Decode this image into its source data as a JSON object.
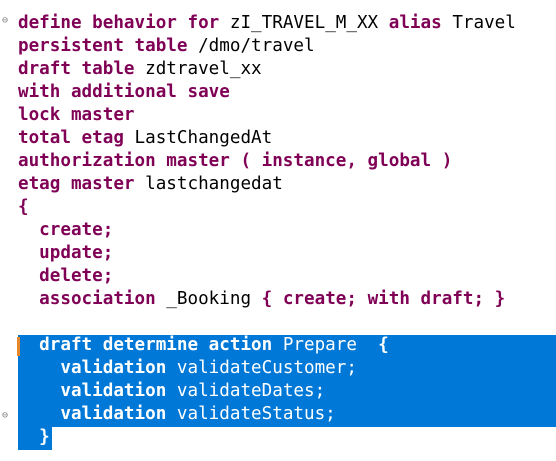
{
  "editor": {
    "folding_marker": "⊖",
    "lines": [
      {
        "segments": [
          {
            "t": "kw",
            "v": "define behavior for "
          },
          {
            "t": "id",
            "v": "zI_TRAVEL_M_XX "
          },
          {
            "t": "kw",
            "v": "alias "
          },
          {
            "t": "id",
            "v": "Travel"
          }
        ]
      },
      {
        "segments": [
          {
            "t": "kw",
            "v": "persistent table "
          },
          {
            "t": "id",
            "v": "/dmo/travel"
          }
        ]
      },
      {
        "segments": [
          {
            "t": "kw",
            "v": "draft table "
          },
          {
            "t": "id",
            "v": "zdtravel_xx"
          }
        ]
      },
      {
        "segments": [
          {
            "t": "kw",
            "v": "with additional save"
          }
        ]
      },
      {
        "segments": [
          {
            "t": "kw",
            "v": "lock master"
          }
        ]
      },
      {
        "segments": [
          {
            "t": "kw",
            "v": "total etag "
          },
          {
            "t": "id",
            "v": "LastChangedAt"
          }
        ]
      },
      {
        "segments": [
          {
            "t": "kw",
            "v": "authorization master ( instance, global )"
          }
        ]
      },
      {
        "segments": [
          {
            "t": "kw",
            "v": "etag master "
          },
          {
            "t": "id",
            "v": "lastchangedat"
          }
        ]
      },
      {
        "segments": [
          {
            "t": "kw",
            "v": "{"
          }
        ]
      },
      {
        "segments": [
          {
            "t": "kw",
            "v": "  create;"
          }
        ]
      },
      {
        "segments": [
          {
            "t": "kw",
            "v": "  update;"
          }
        ]
      },
      {
        "segments": [
          {
            "t": "kw",
            "v": "  delete;"
          }
        ]
      },
      {
        "segments": [
          {
            "t": "kw",
            "v": "  association "
          },
          {
            "t": "id",
            "v": "_Booking "
          },
          {
            "t": "kw",
            "v": "{ create; with draft; }"
          }
        ]
      },
      {
        "segments": [
          {
            "t": "id",
            "v": ""
          }
        ]
      },
      {
        "segments": [
          {
            "t": "kw",
            "v": "  draft determine action "
          },
          {
            "t": "id",
            "v": "Prepare  "
          },
          {
            "t": "kw",
            "v": "{"
          }
        ]
      },
      {
        "segments": [
          {
            "t": "kw",
            "v": "    validation "
          },
          {
            "t": "id",
            "v": "validateCustomer;"
          }
        ]
      },
      {
        "segments": [
          {
            "t": "kw",
            "v": "    validation "
          },
          {
            "t": "id",
            "v": "validateDates;"
          }
        ]
      },
      {
        "segments": [
          {
            "t": "kw",
            "v": "    validation "
          },
          {
            "t": "id",
            "v": "validateStatus;"
          }
        ]
      },
      {
        "segments": [
          {
            "t": "kw",
            "v": "  }"
          }
        ]
      }
    ]
  }
}
